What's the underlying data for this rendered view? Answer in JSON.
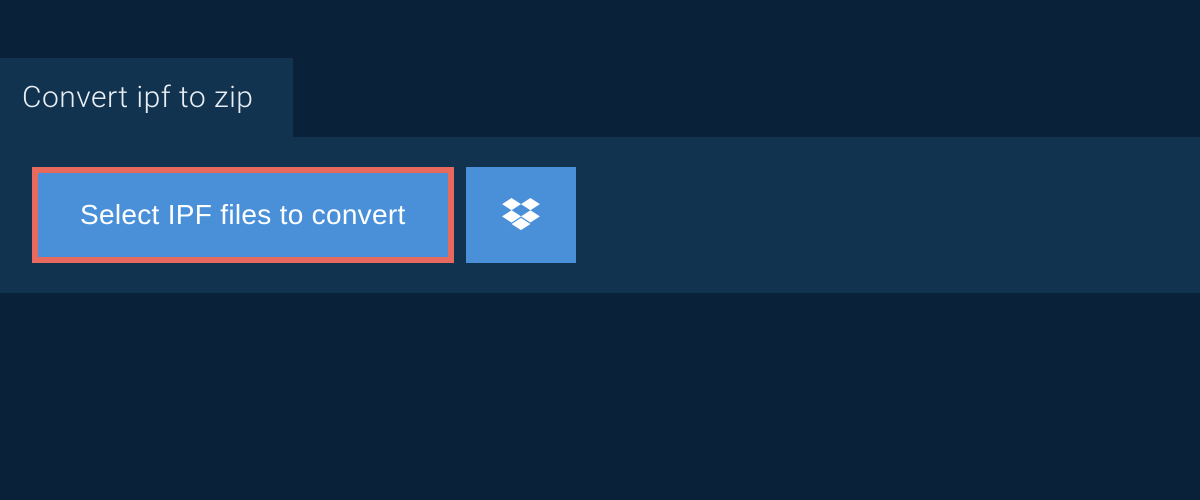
{
  "tab": {
    "title": "Convert ipf to zip"
  },
  "actions": {
    "select_label": "Select IPF files to convert"
  }
}
